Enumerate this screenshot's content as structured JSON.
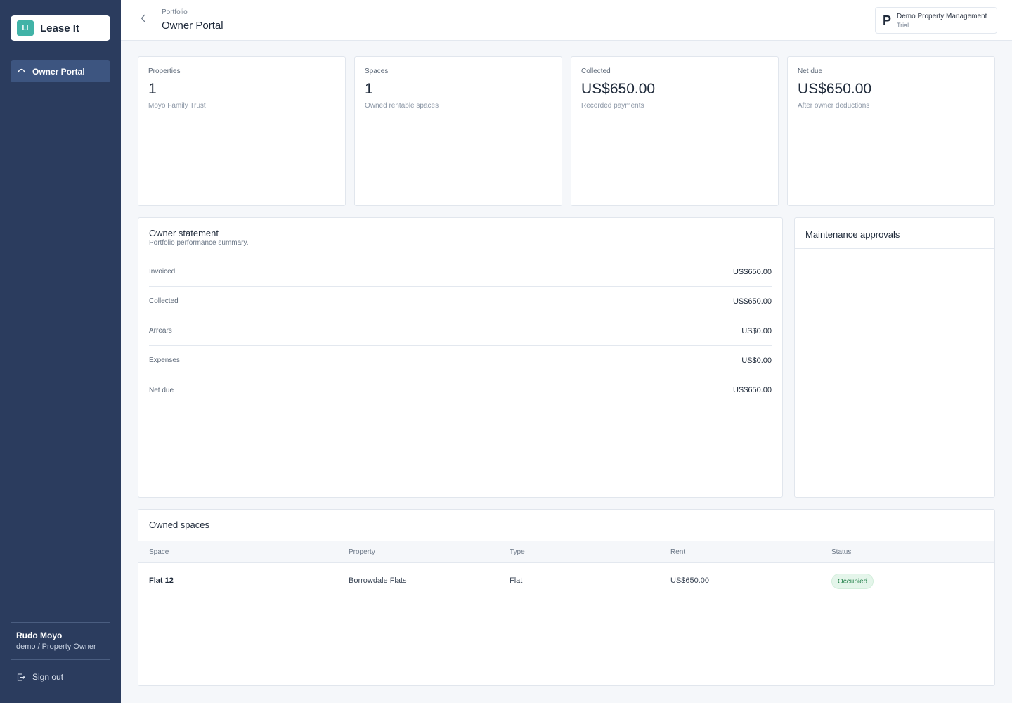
{
  "sidebar": {
    "brand": {
      "logo_text": "LI",
      "name": "Lease It",
      "logo_color": "#41b3a7"
    },
    "nav": [
      {
        "label": "Owner Portal",
        "icon": "spinner-icon",
        "active": true
      }
    ],
    "user": {
      "name": "Rudo Moyo",
      "role": "demo / Property Owner"
    },
    "signout_label": "Sign out",
    "background": "#2b3c5e"
  },
  "header": {
    "breadcrumb": "Portfolio",
    "title": "Owner Portal",
    "org": {
      "letter": "P",
      "name": "Demo Property Management",
      "plan": "Trial"
    }
  },
  "stats": [
    {
      "label": "Properties",
      "value": "1",
      "sub": "Moyo Family Trust"
    },
    {
      "label": "Spaces",
      "value": "1",
      "sub": "Owned rentable spaces"
    },
    {
      "label": "Collected",
      "value": "US$650.00",
      "sub": "Recorded payments"
    },
    {
      "label": "Net due",
      "value": "US$650.00",
      "sub": "After owner deductions"
    }
  ],
  "statement": {
    "title": "Owner statement",
    "subtitle": "Portfolio performance summary.",
    "rows": [
      {
        "label": "Invoiced",
        "value": "US$650.00"
      },
      {
        "label": "Collected",
        "value": "US$650.00"
      },
      {
        "label": "Arrears",
        "value": "US$0.00"
      },
      {
        "label": "Expenses",
        "value": "US$0.00"
      },
      {
        "label": "Net due",
        "value": "US$650.00"
      }
    ]
  },
  "maintenance": {
    "title": "Maintenance approvals"
  },
  "spaces": {
    "title": "Owned spaces",
    "columns": [
      "Space",
      "Property",
      "Type",
      "Rent",
      "Status"
    ],
    "rows": [
      {
        "space": "Flat 12",
        "property": "Borrowdale Flats",
        "type": "Flat",
        "rent": "US$650.00",
        "status": "Occupied"
      }
    ],
    "status_color": "#23804a"
  }
}
